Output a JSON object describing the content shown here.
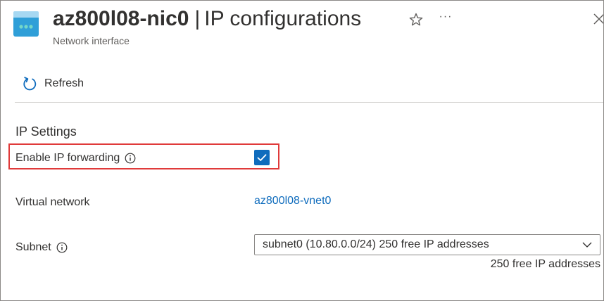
{
  "header": {
    "resource_name": "az800l08-nic0",
    "separator": "|",
    "page_title": "IP configurations",
    "resource_type": "Network interface",
    "more_label": "···",
    "icon": "network-interface-icon"
  },
  "toolbar": {
    "refresh_label": "Refresh",
    "refresh_icon": "refresh-icon"
  },
  "ip_settings": {
    "heading": "IP Settings",
    "ip_forwarding": {
      "label": "Enable IP forwarding",
      "checked": true
    },
    "virtual_network": {
      "label": "Virtual network",
      "value": "az800l08-vnet0"
    },
    "subnet": {
      "label": "Subnet",
      "selected": "subnet0 (10.80.0.0/24) 250 free IP addresses",
      "helper": "250 free IP addresses"
    }
  },
  "colors": {
    "accent": "#0f6cbd",
    "highlight": "#e03a3a",
    "icon_blue": "#2f9fd8",
    "icon_teal": "#74d7c8"
  }
}
